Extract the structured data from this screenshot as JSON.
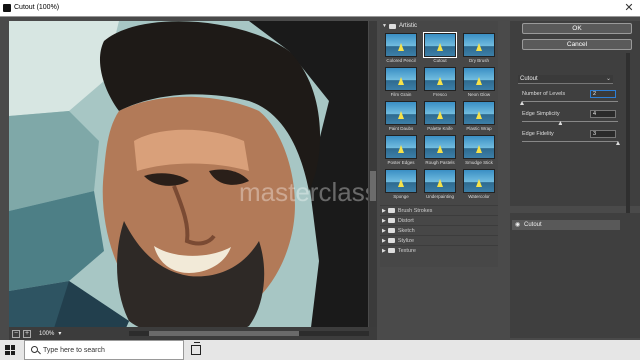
{
  "window": {
    "title": "Cutout (100%)",
    "close_glyph": "✕",
    "icon": "photoshop-icon"
  },
  "preview": {
    "watermark": "masterclass",
    "zoom": "100%",
    "zoom_minus": "−",
    "zoom_plus": "+",
    "dropdown_glyph": "▾"
  },
  "gallery": {
    "group": "Artistic",
    "filters": [
      {
        "label": "Colored Pencil",
        "selected": false
      },
      {
        "label": "Cutout",
        "selected": true
      },
      {
        "label": "Dry Brush",
        "selected": false
      },
      {
        "label": "Film Grain",
        "selected": false
      },
      {
        "label": "Fresco",
        "selected": false
      },
      {
        "label": "Neon Glow",
        "selected": false
      },
      {
        "label": "Paint Daubs",
        "selected": false
      },
      {
        "label": "Palette Knife",
        "selected": false
      },
      {
        "label": "Plastic Wrap",
        "selected": false
      },
      {
        "label": "Poster Edges",
        "selected": false
      },
      {
        "label": "Rough Pastels",
        "selected": false
      },
      {
        "label": "Smudge Stick",
        "selected": false
      },
      {
        "label": "Sponge",
        "selected": false
      },
      {
        "label": "Underpainting",
        "selected": false
      },
      {
        "label": "Watercolor",
        "selected": false
      }
    ],
    "categories": [
      "Brush Strokes",
      "Distort",
      "Sketch",
      "Stylize",
      "Texture"
    ]
  },
  "settings": {
    "ok_label": "OK",
    "cancel_label": "Cancel",
    "filter_select": "Cutout",
    "sliders": [
      {
        "label": "Number of Levels",
        "value": "2",
        "position": 0.0
      },
      {
        "label": "Edge Simplicity",
        "value": "4",
        "position": 0.4
      },
      {
        "label": "Edge Fidelity",
        "value": "3",
        "position": 1.0
      }
    ]
  },
  "layers": {
    "items": [
      {
        "name": "Cutout",
        "visible": true
      }
    ]
  },
  "taskbar": {
    "search_placeholder": "Type here to search"
  },
  "colors": {
    "accent": "#2e7fd6",
    "panel": "#474747",
    "dialog_bg": "#4a4a4a"
  }
}
